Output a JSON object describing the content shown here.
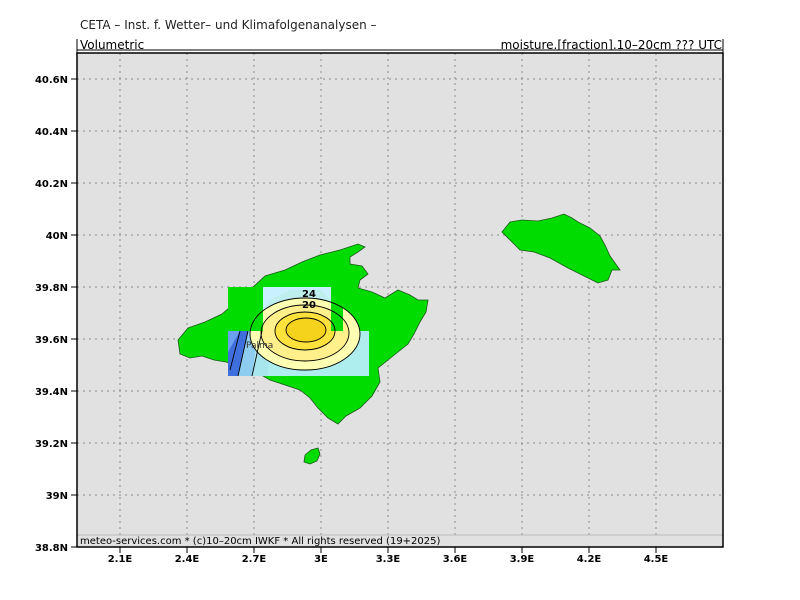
{
  "header": {
    "title": "CETA – Inst. f. Wetter– und Klimafolgenanalysen –",
    "variable_type": "Volumetric",
    "field_label": "moisture.[fraction].10–20cm ??? UTC"
  },
  "axes": {
    "lat_labels": [
      "40.6N",
      "40.4N",
      "40.2N",
      "40N",
      "39.8N",
      "39.6N",
      "39.4N",
      "39.2N",
      "39N",
      "38.8N"
    ],
    "lon_labels": [
      "2.1E",
      "2.4E",
      "2.7E",
      "3E",
      "3.3E",
      "3.6E",
      "3.9E",
      "4.2E",
      "4.5E"
    ]
  },
  "map": {
    "colors": {
      "background": "#e1e1e1",
      "land": "#00dc00",
      "grid": "#888888"
    },
    "contour_labels": [
      "24",
      "20"
    ],
    "place_labels": [
      "Palma"
    ]
  },
  "footer": {
    "text": "meteo-services.com * (c)10–20cm IWKF * All rights reserved (19+2025)"
  }
}
